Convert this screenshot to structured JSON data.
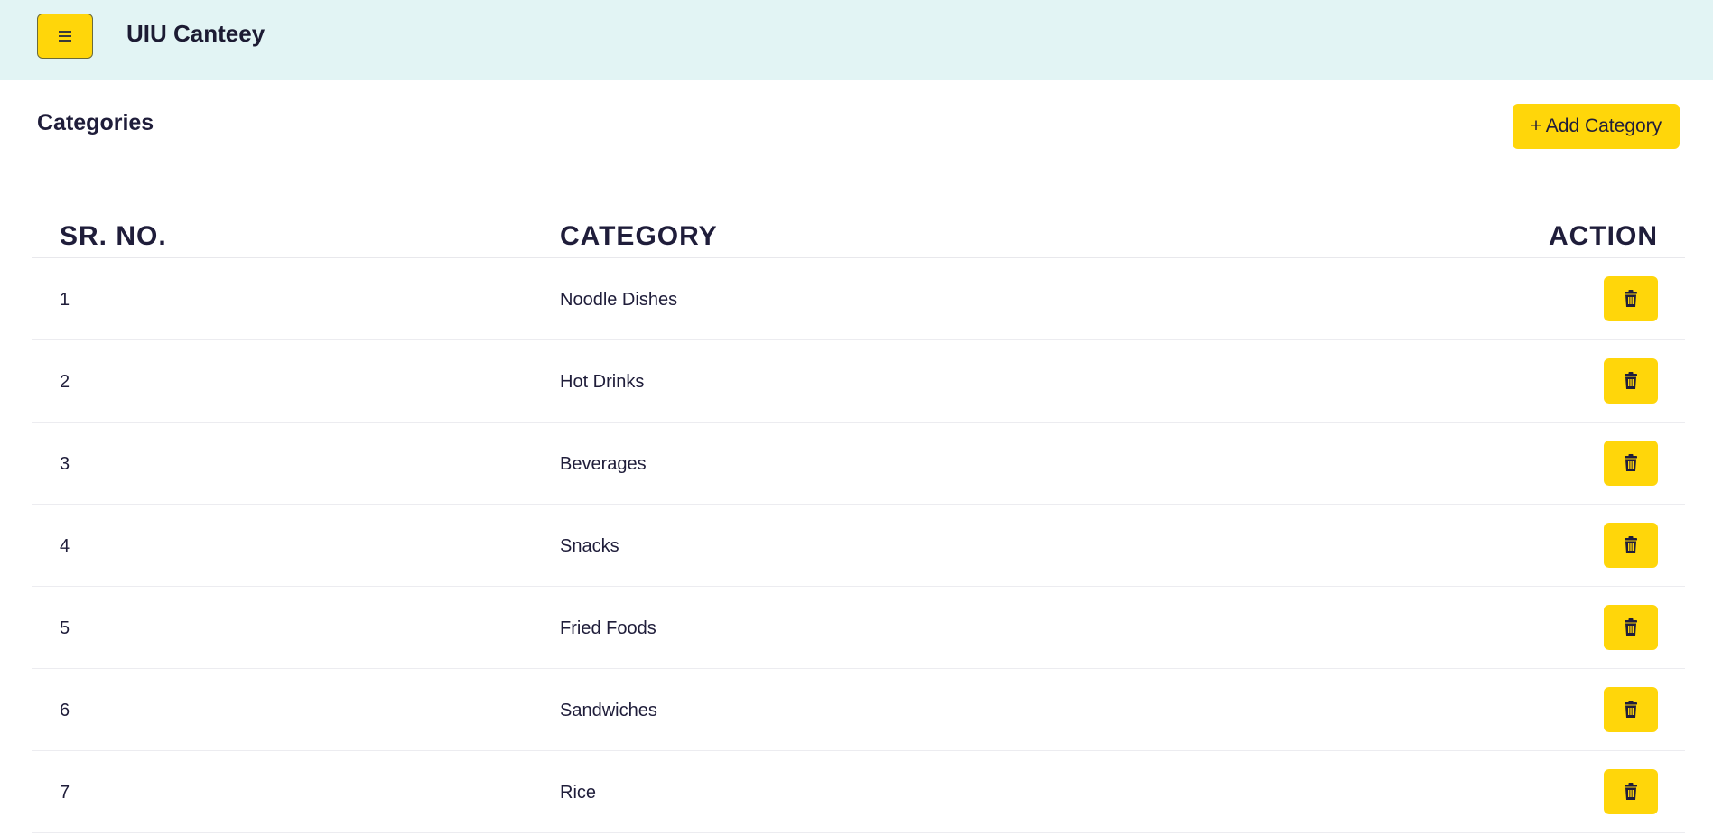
{
  "header": {
    "app_title": "UIU Canteey",
    "menu_icon": "hamburger-icon"
  },
  "page": {
    "title": "Categories",
    "add_button_label": "+ Add Category"
  },
  "table": {
    "columns": [
      "SR. NO.",
      "CATEGORY",
      "ACTION"
    ],
    "rows": [
      {
        "sr": "1",
        "category": "Noodle Dishes"
      },
      {
        "sr": "2",
        "category": "Hot Drinks"
      },
      {
        "sr": "3",
        "category": "Beverages"
      },
      {
        "sr": "4",
        "category": "Snacks"
      },
      {
        "sr": "5",
        "category": "Fried Foods"
      },
      {
        "sr": "6",
        "category": "Sandwiches"
      },
      {
        "sr": "7",
        "category": "Rice"
      }
    ],
    "action_icon": "trash-icon"
  },
  "colors": {
    "header_bg": "#e2f4f4",
    "accent": "#ffd60a",
    "text": "#1f1d3a"
  }
}
